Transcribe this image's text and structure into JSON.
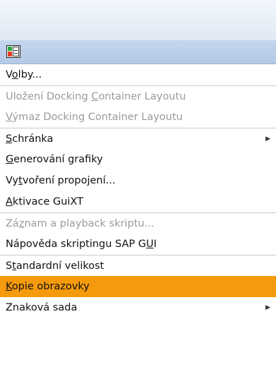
{
  "menu": {
    "items": [
      {
        "id": "volby",
        "pre": "V",
        "u": "o",
        "post": "lby...",
        "enabled": true
      },
      {
        "id": "ulozeni-docking-container-layoutu",
        "pre": "Uložení Docking ",
        "u": "C",
        "post": "ontainer Layoutu",
        "enabled": false
      },
      {
        "id": "vymaz-docking-container-layoutu",
        "pre": "",
        "u": "V",
        "post": "ýmaz Docking Container Layoutu",
        "enabled": false
      },
      {
        "id": "schranka",
        "pre": "",
        "u": "S",
        "post": "chránka",
        "enabled": true,
        "submenu": true
      },
      {
        "id": "generovani-grafiky",
        "pre": "",
        "u": "G",
        "post": "enerování grafiky",
        "enabled": true
      },
      {
        "id": "vytvoreni-propojeni",
        "pre": "Vy",
        "u": "t",
        "post": "voření propojení...",
        "enabled": true
      },
      {
        "id": "aktivace-guixt",
        "pre": "",
        "u": "A",
        "post": "ktivace GuiXT",
        "enabled": true
      },
      {
        "id": "zaznam-a-playback-skriptu",
        "pre": "Zá",
        "u": "z",
        "post": "nam a playback skriptu...",
        "enabled": false
      },
      {
        "id": "napoveda-skriptingu",
        "pre": "Nápověda skriptingu SAP G",
        "u": "U",
        "post": "I",
        "enabled": true
      },
      {
        "id": "standardni-velikost",
        "pre": "S",
        "u": "t",
        "post": "andardní velikost",
        "enabled": true
      },
      {
        "id": "kopie-obrazovky",
        "pre": "",
        "u": "K",
        "post": "opie obrazovky",
        "enabled": true,
        "selected": true
      },
      {
        "id": "znakova-sada",
        "pre": "Znaková sada",
        "u": "",
        "post": "",
        "enabled": true,
        "submenu": true
      }
    ]
  },
  "icons": {
    "system_menu": "sap-system-menu-icon",
    "submenu_arrow": "submenu-arrow-icon"
  },
  "colors": {
    "selected_bg": "#f59a0c",
    "disabled_text": "#9a9a9a",
    "icon_bar_bg": "#b4c9e6"
  }
}
